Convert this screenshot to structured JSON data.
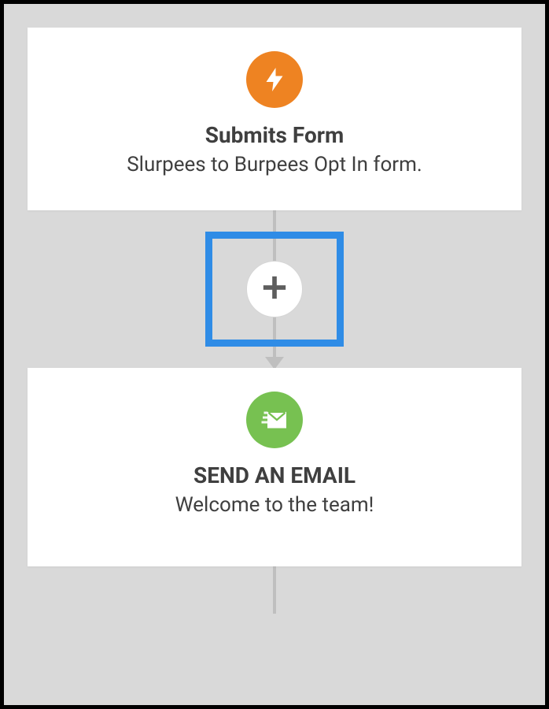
{
  "steps": [
    {
      "title": "Submits Form",
      "subtitle": "Slurpees to Burpees Opt In form.",
      "iconColor": "orange",
      "icon": "lightning"
    },
    {
      "title": "SEND AN EMAIL",
      "subtitle": "Welcome to the team!",
      "iconColor": "green",
      "icon": "send-email"
    }
  ],
  "addButton": {
    "highlighted": true
  }
}
